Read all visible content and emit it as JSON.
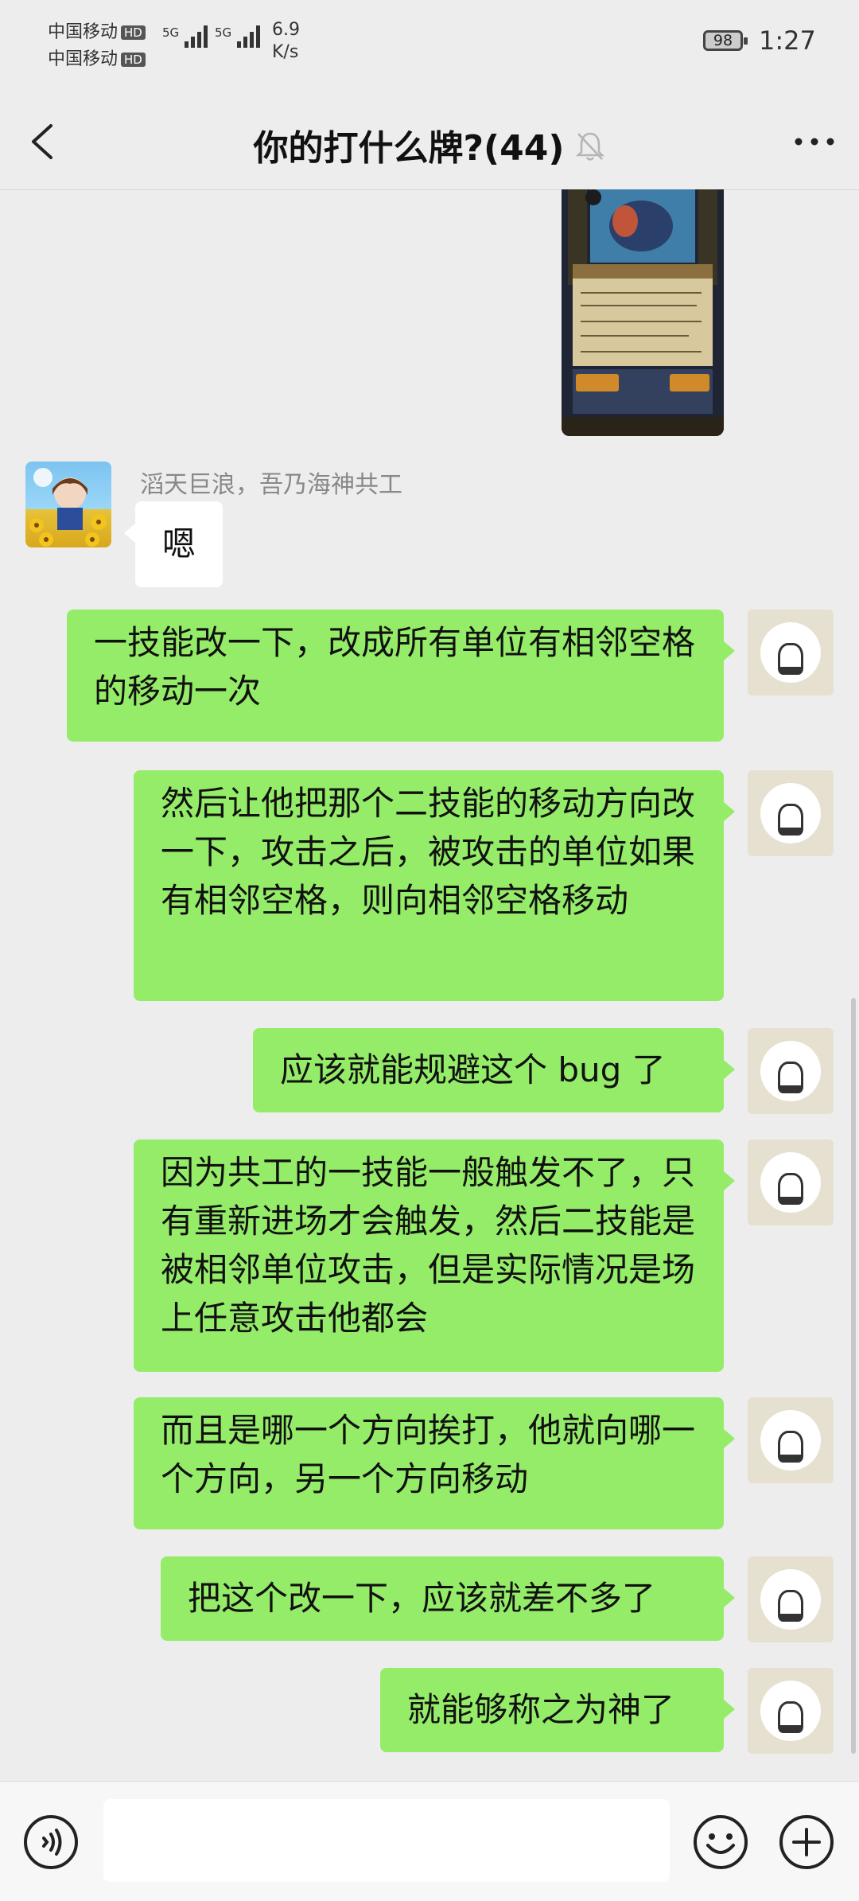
{
  "status_bar": {
    "carrier_1": "中国移动",
    "carrier_2": "中国移动",
    "hd_1": "HD",
    "hd_2": "HD",
    "net_1": "5G",
    "net_2": "5G",
    "speed_value": "6.9",
    "speed_unit": "K/s",
    "battery": "98",
    "time": "1:27"
  },
  "header": {
    "title": "你的打什么牌?(44)",
    "icons": {
      "back": "chevron-left-icon",
      "mute": "bell-off-icon",
      "more": "more-dots-icon"
    }
  },
  "messages": {
    "incoming": {
      "sender": "滔天巨浪，吾乃海神共工",
      "text": "嗯"
    },
    "outgoing": [
      "一技能改一下，改成所有单位有相邻空格的移动一次",
      "然后让他把那个二技能的移动方向改一下，攻击之后，被攻击的单位如果有相邻空格，则向相邻空格移动",
      "应该就能规避这个 bug 了",
      "因为共工的一技能一般触发不了，只有重新进场才会触发，然后二技能是被相邻单位攻击，但是实际情况是场上任意攻击他都会",
      "而且是哪一个方向挨打，他就向哪一个方向，另一个方向移动",
      "把这个改一下，应该就差不多了",
      "就能够称之为神了"
    ]
  },
  "input_bar": {
    "icons": {
      "voice": "voice-icon",
      "emoji": "emoji-icon",
      "plus": "plus-icon"
    }
  },
  "colors": {
    "background": "#ededed",
    "outgoing_bubble": "#95ec69",
    "incoming_bubble": "#ffffff"
  }
}
